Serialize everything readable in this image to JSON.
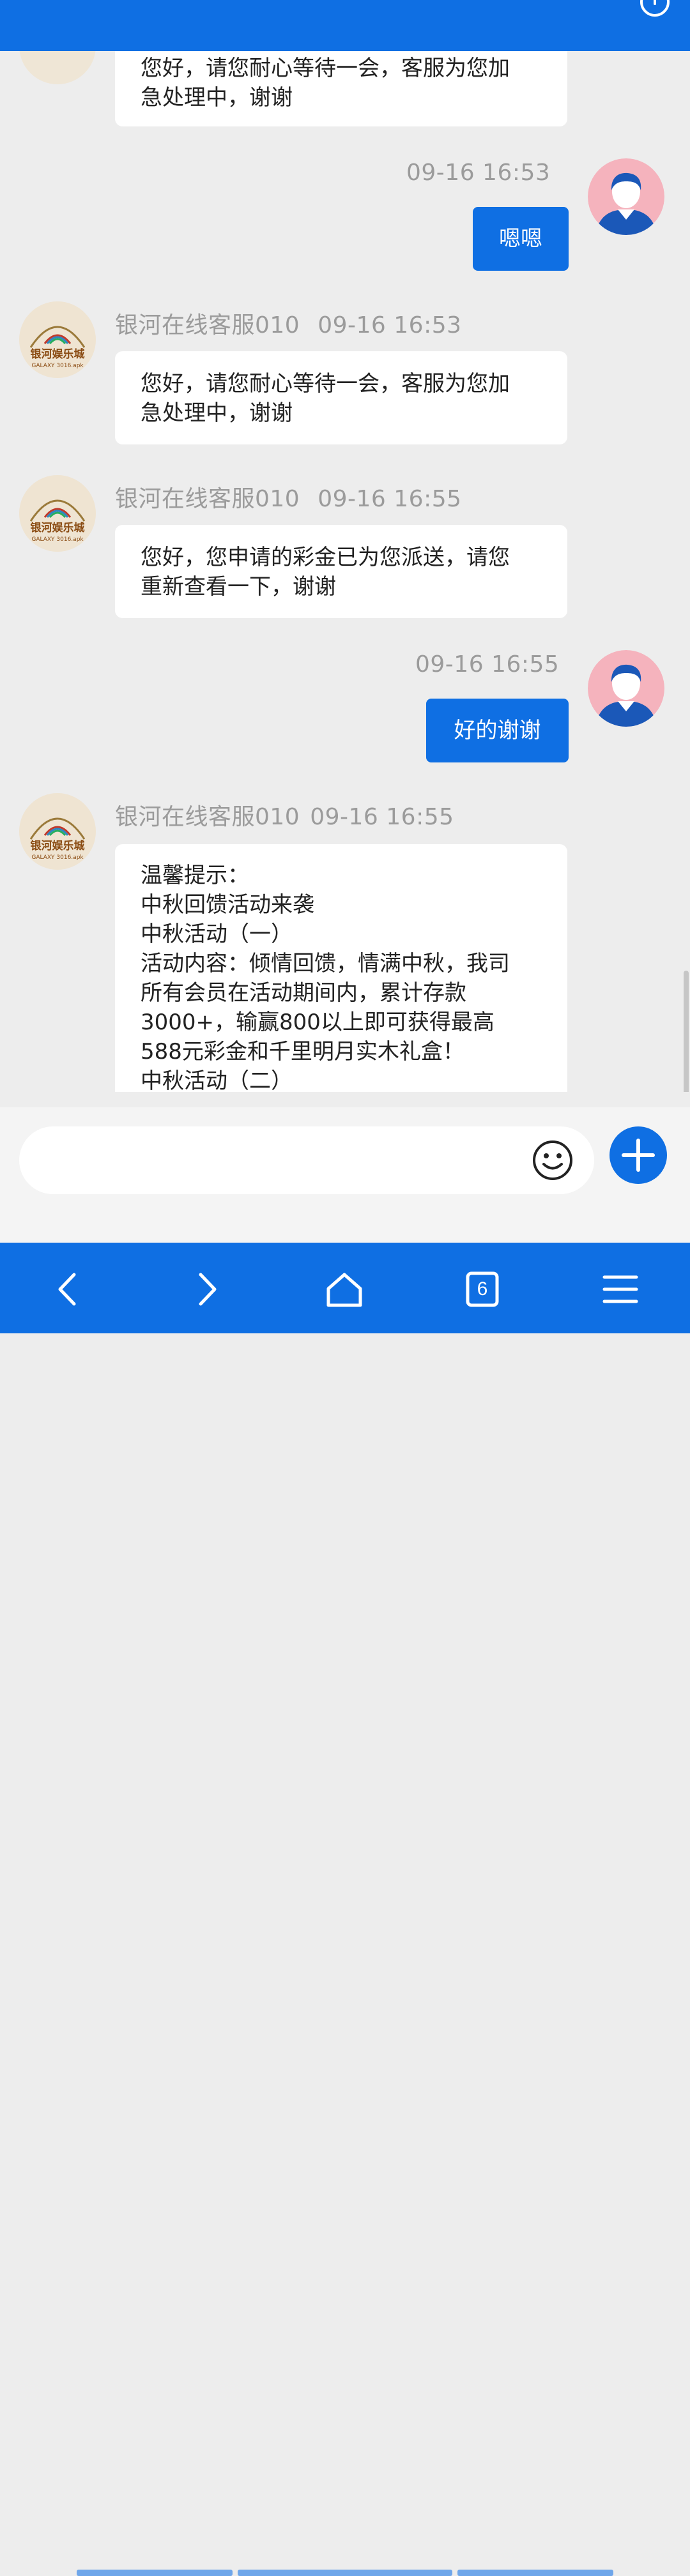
{
  "messages": [
    {
      "text_lines": [
        "您好，请您耐心等待一会，客服为您加",
        "急处理中，谢谢"
      ]
    },
    {
      "time": "09-16 16:53",
      "text": "嗯嗯"
    },
    {
      "sender": "银河在线客服010",
      "time": "09-16 16:53",
      "text_lines": [
        "您好，请您耐心等待一会，客服为您加",
        "急处理中，谢谢"
      ]
    },
    {
      "sender": "银河在线客服010",
      "time": "09-16 16:55",
      "text_lines": [
        "您好，您申请的彩金已为您派送，请您",
        "重新查看一下，谢谢"
      ]
    },
    {
      "time": "09-16 16:55",
      "text": "好的谢谢"
    },
    {
      "sender": "银河在线客服010",
      "time": "09-16 16:55",
      "text_lines": [
        "温馨提示：",
        "中秋回馈活动来袭",
        "中秋活动（一）",
        "活动内容：倾情回馈，情满中秋，我司",
        "所有会员在活动期间内，累计存款",
        "3000+，输赢800以上即可获得最高",
        "588元彩金和千里明月实木礼盒！",
        "中秋活动（二）"
      ]
    }
  ],
  "agent_avatar": {
    "title": "银河娱乐城",
    "subtitle": "GALAXY 3016.apk"
  },
  "composer": {
    "placeholder": ""
  },
  "icons": {
    "power": "power-icon",
    "emoji": "emoji-icon",
    "plus": "plus-icon",
    "back": "back-icon",
    "forward": "forward-icon",
    "home": "home-icon",
    "tabs": "tabs-icon",
    "menu": "menu-icon"
  },
  "navbar": {
    "tab_count": "6"
  },
  "colors": {
    "accent": "#0f6fe3",
    "background": "#ededed",
    "bubble_in": "#ffffff",
    "meta_text": "#9b9b9b"
  }
}
